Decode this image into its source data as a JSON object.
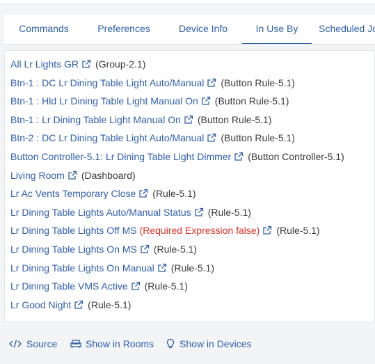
{
  "tabs": [
    {
      "label": "Commands",
      "active": false
    },
    {
      "label": "Preferences",
      "active": false
    },
    {
      "label": "Device Info",
      "active": false
    },
    {
      "label": "In Use By",
      "active": true
    },
    {
      "label": "Scheduled Jobs",
      "active": false
    }
  ],
  "items": [
    {
      "name": "All Lr Lights GR",
      "note": "",
      "type": "(Group-2.1)"
    },
    {
      "name": "Btn-1 : DC Lr Dining Table Light Auto/Manual",
      "note": "",
      "type": "(Button Rule-5.1)"
    },
    {
      "name": "Btn-1 : Hld Lr Dining Table Light Manual On",
      "note": "",
      "type": "(Button Rule-5.1)"
    },
    {
      "name": "Btn-1 : Lr Dining Table Light Manual On",
      "note": "",
      "type": "(Button Rule-5.1)"
    },
    {
      "name": "Btn-2 : DC Lr Dining Table Light Auto/Manual",
      "note": "",
      "type": "(Button Rule-5.1)"
    },
    {
      "name": "Button Controller-5.1: Lr Dining Table Light Dimmer",
      "note": "",
      "type": "(Button Controller-5.1)"
    },
    {
      "name": "Living Room",
      "note": "",
      "type": "(Dashboard)"
    },
    {
      "name": "Lr Ac Vents Temporary Close",
      "note": "",
      "type": "(Rule-5.1)"
    },
    {
      "name": "Lr Dining Table Lights Auto/Manual Status",
      "note": "",
      "type": "(Rule-5.1)"
    },
    {
      "name": "Lr Dining Table Lights Off MS",
      "note": "(Required Expression false)",
      "type": "(Rule-5.1)"
    },
    {
      "name": "Lr Dining Table Lights On MS",
      "note": "",
      "type": "(Rule-5.1)"
    },
    {
      "name": "Lr Dining Table Lights On Manual",
      "note": "",
      "type": "(Rule-5.1)"
    },
    {
      "name": "Lr Dining Table VMS Active",
      "note": "",
      "type": "(Rule-5.1)"
    },
    {
      "name": "Lr Good Night",
      "note": "",
      "type": "(Rule-5.1)"
    }
  ],
  "footer": {
    "source_label": "Source",
    "rooms_label": "Show in Rooms",
    "devices_label": "Show in Devices"
  },
  "icons": {
    "item_link": "external-link-icon",
    "source": "code-icon",
    "rooms": "sofa-icon",
    "devices": "lightbulb-icon"
  },
  "colors": {
    "link": "#2f5fae",
    "warning": "#d93025",
    "type_text": "#3a3a3a",
    "background": "#f3f4f6"
  }
}
